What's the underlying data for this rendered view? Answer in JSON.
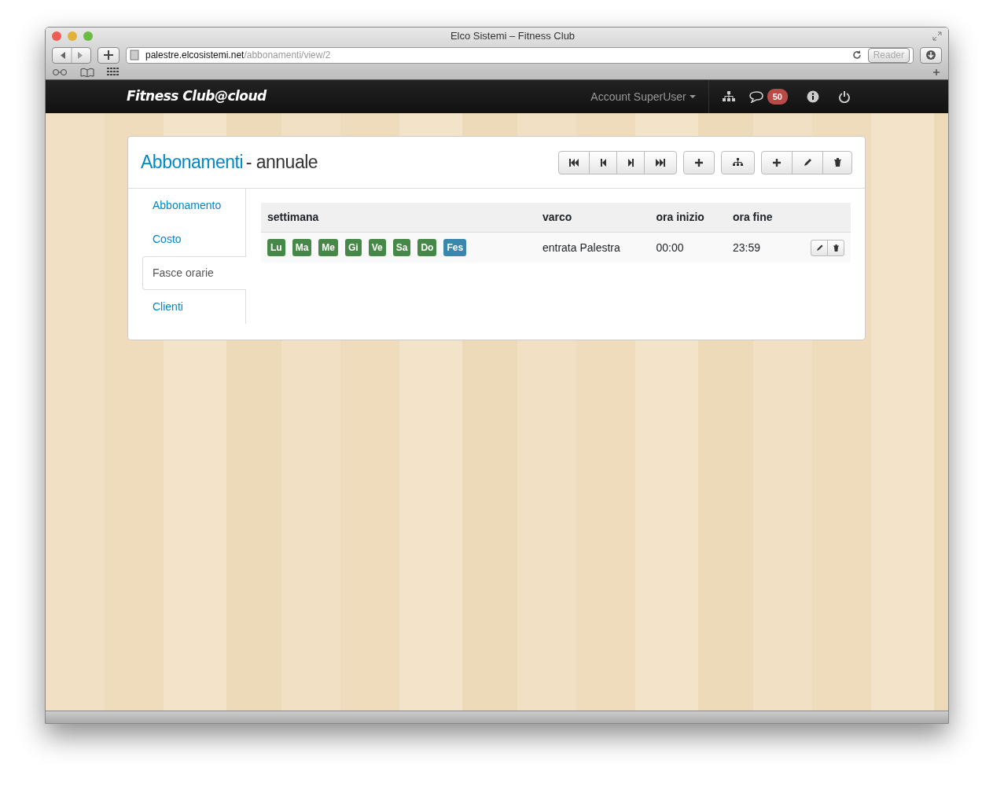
{
  "window": {
    "title": "Elco Sistemi – Fitness Club"
  },
  "address_bar": {
    "domain": "palestre.elcosistemi.net",
    "path": "/abbonamenti/view/2",
    "reader": "Reader"
  },
  "navbar": {
    "brand": "Fitness Club@cloud",
    "account": "Account SuperUser",
    "messages_badge": "50"
  },
  "page": {
    "title": "Abbonamenti",
    "subtitle": "- annuale"
  },
  "tabs": [
    {
      "label": "Abbonamento",
      "selected": false
    },
    {
      "label": "Costo",
      "selected": false
    },
    {
      "label": "Fasce orarie",
      "selected": true
    },
    {
      "label": "Clienti",
      "selected": false
    }
  ],
  "table": {
    "columns": [
      "settimana",
      "varco",
      "ora inizio",
      "ora fine"
    ],
    "rows": [
      {
        "days": [
          {
            "label": "Lu",
            "color": "#468847"
          },
          {
            "label": "Ma",
            "color": "#468847"
          },
          {
            "label": "Me",
            "color": "#468847"
          },
          {
            "label": "Gi",
            "color": "#468847"
          },
          {
            "label": "Ve",
            "color": "#468847"
          },
          {
            "label": "Sa",
            "color": "#468847"
          },
          {
            "label": "Do",
            "color": "#468847"
          },
          {
            "label": "Fes",
            "color": "#3a87ad"
          }
        ],
        "varco": "entrata Palestra",
        "start": "00:00",
        "end": "23:59"
      }
    ]
  }
}
